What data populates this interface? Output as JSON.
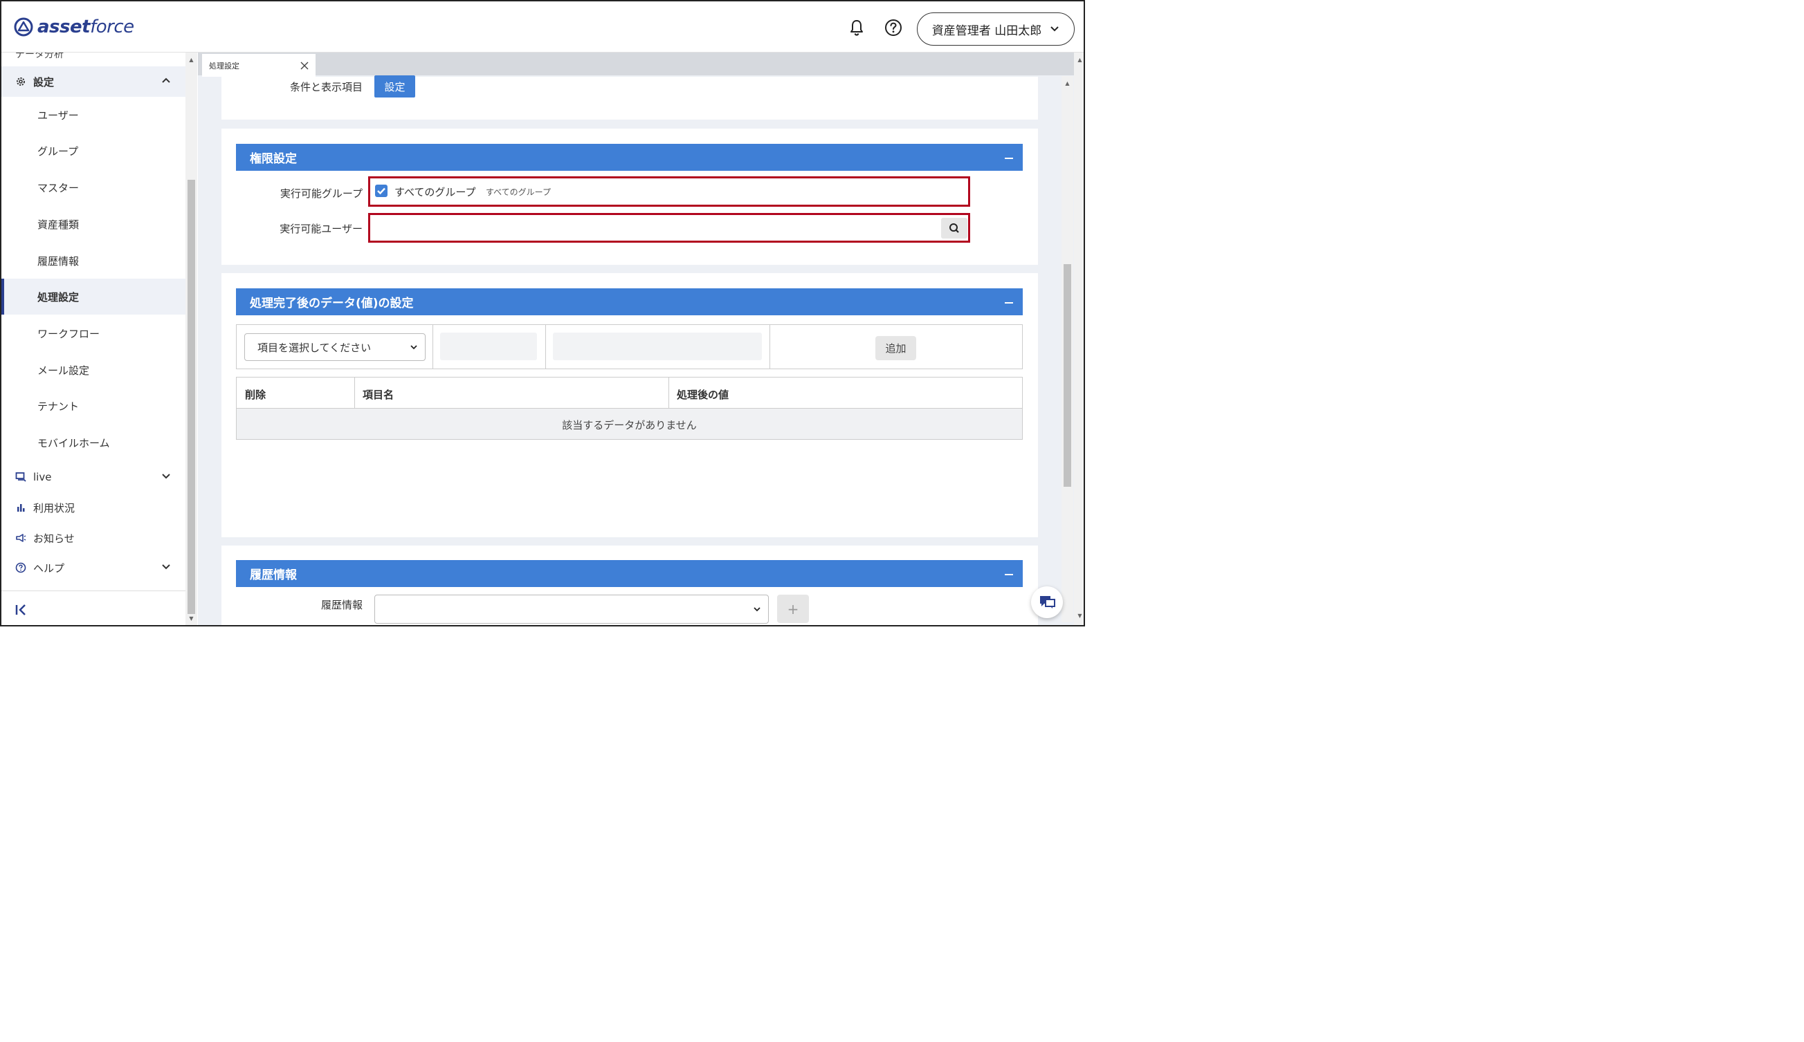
{
  "header": {
    "logo_text_bold": "asset",
    "logo_text": "force",
    "user_label": "資産管理者 山田太郎"
  },
  "sidebar": {
    "cut_item": "データ分析",
    "settings_label": "設定",
    "sub_items": [
      "ユーザー",
      "グループ",
      "マスター",
      "資産種類",
      "履歴情報",
      "処理設定",
      "ワークフロー",
      "メール設定",
      "テナント",
      "モバイルホーム"
    ],
    "active_sub_index": 5,
    "live_label": "live",
    "usage_label": "利用状況",
    "notice_label": "お知らせ",
    "help_label": "ヘルプ"
  },
  "tab": {
    "label": "処理設定"
  },
  "top_card": {
    "conditions_label": "条件と表示項目",
    "settings_button": "設定"
  },
  "permission": {
    "title": "権限設定",
    "group_label": "実行可能グループ",
    "all_groups_checkbox_label": "すべてのグループ",
    "all_groups_note": "すべてのグループ",
    "all_groups_checked": true,
    "user_label": "実行可能ユーザー",
    "user_value": ""
  },
  "post_process": {
    "title": "処理完了後のデータ(値)の設定",
    "select_placeholder": "項目を選択してください",
    "add_button": "追加",
    "table_headers": [
      "削除",
      "項目名",
      "処理後の値"
    ],
    "empty_text": "該当するデータがありません"
  },
  "history": {
    "title": "履歴情報",
    "field_label": "履歴情報",
    "select_value": "",
    "plus_button": "+"
  },
  "colors": {
    "accent": "#3f7fd6",
    "highlight": "#b2071f",
    "logo": "#2a3f8f"
  }
}
